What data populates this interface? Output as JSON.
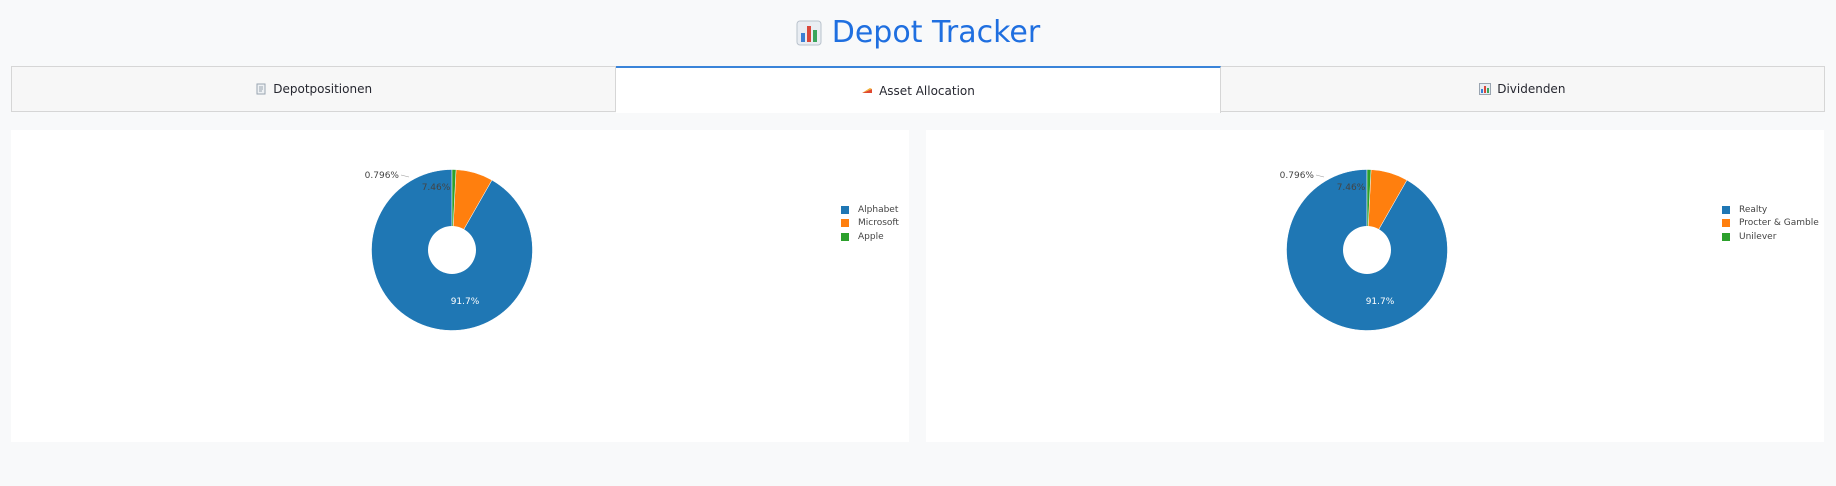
{
  "app": {
    "title": "Depot Tracker",
    "title_icon": "bar-chart-icon"
  },
  "tabs": [
    {
      "label": "Depotpositionen",
      "icon": "document-icon",
      "active": false
    },
    {
      "label": "Asset Allocation",
      "icon": "pie-chart-icon",
      "active": true
    },
    {
      "label": "Dividenden",
      "icon": "bar-chart-icon",
      "active": false
    }
  ],
  "colors": {
    "accent": "#1f6fe0",
    "tab_active_border": "#3a84d9",
    "series": [
      "#1f77b4",
      "#ff7f0e",
      "#2ca02c"
    ]
  },
  "chart_data": [
    {
      "type": "pie",
      "hole": true,
      "categories": [
        "Alphabet",
        "Microsoft",
        "Apple"
      ],
      "values": [
        91.7,
        7.46,
        0.796
      ],
      "data_labels": [
        "91.7%",
        "7.46%",
        "0.796%"
      ],
      "legend_position": "top-right"
    },
    {
      "type": "pie",
      "hole": true,
      "categories": [
        "Realty",
        "Procter & Gamble",
        "Unilever"
      ],
      "values": [
        91.7,
        7.46,
        0.796
      ],
      "data_labels": [
        "91.7%",
        "7.46%",
        "0.796%"
      ],
      "legend_position": "top-right"
    }
  ]
}
